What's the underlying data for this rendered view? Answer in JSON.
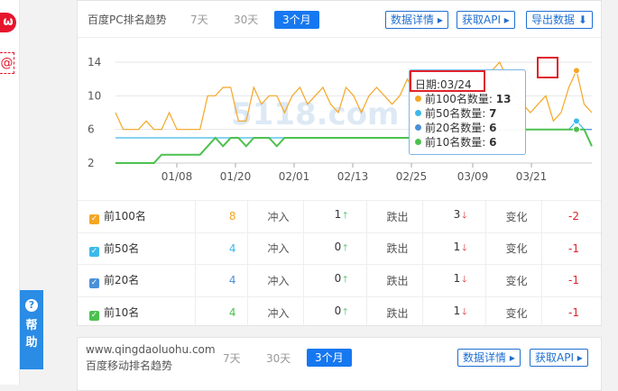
{
  "side": {
    "weibo_icon": "weibo-icon",
    "mail_icon": "mail-icon",
    "help_label": "帮助",
    "help_q": "?"
  },
  "card1": {
    "title": "百度PC排名趋势",
    "tabs": [
      "7天",
      "30天",
      "3个月"
    ],
    "buttons": {
      "detail": "数据详情 ▸",
      "api": "获取API ▸",
      "export": "导出数据 ⬇"
    }
  },
  "tooltip": {
    "date": "日期:03/24",
    "rows": [
      {
        "label": "前100名数量:",
        "value": "13",
        "color": "#f5a623"
      },
      {
        "label": "前50名数量:",
        "value": "7",
        "color": "#3cb9ea"
      },
      {
        "label": "前20名数量:",
        "value": "6",
        "color": "#4a90d9"
      },
      {
        "label": "前10名数量:",
        "value": "6",
        "color": "#4cc14f"
      }
    ]
  },
  "chart_data": {
    "type": "line",
    "yticks": [
      2,
      6,
      10,
      14
    ],
    "ylim": [
      2,
      14
    ],
    "xticks": [
      "01/08",
      "01/20",
      "02/01",
      "02/13",
      "02/25",
      "03/09",
      "03/21"
    ],
    "grid": true,
    "watermark": "5118.com",
    "series": [
      {
        "name": "前100名",
        "color": "#f5a623",
        "values": [
          8,
          6,
          6,
          6,
          7,
          6,
          6,
          8,
          6,
          6,
          6,
          6,
          10,
          10,
          11,
          11,
          7,
          7,
          11,
          9,
          10,
          10,
          8,
          10,
          11,
          9,
          10,
          11,
          9,
          8,
          11,
          10,
          8,
          10,
          11,
          10,
          9,
          10,
          12,
          10,
          9,
          10,
          11,
          10,
          11,
          12,
          13,
          12,
          11,
          13,
          14,
          12,
          10,
          9,
          8,
          9,
          10,
          7,
          8,
          11,
          13,
          9,
          8
        ]
      },
      {
        "name": "前50名",
        "color": "#3cb9ea",
        "values": [
          5,
          5,
          5,
          5,
          5,
          5,
          5,
          5,
          5,
          5,
          5,
          5,
          5,
          5,
          5,
          5,
          5,
          5,
          5,
          5,
          5,
          5,
          5,
          5,
          5,
          5,
          5,
          5,
          5,
          5,
          5,
          5,
          5,
          5,
          5,
          5,
          5,
          5,
          5,
          5,
          5,
          6,
          6,
          6,
          6,
          6,
          6,
          6,
          6,
          6,
          6,
          6,
          6,
          6,
          6,
          6,
          6,
          6,
          6,
          6,
          7,
          6,
          6
        ]
      },
      {
        "name": "前20名",
        "color": "#4a90d9",
        "values": [
          2,
          2,
          2,
          2,
          2,
          2,
          3,
          3,
          3,
          3,
          3,
          3,
          4,
          5,
          4,
          5,
          5,
          4,
          5,
          5,
          5,
          4,
          5,
          5,
          5,
          5,
          5,
          5,
          5,
          5,
          5,
          5,
          5,
          5,
          5,
          5,
          5,
          5,
          5,
          5,
          5,
          6,
          6,
          6,
          6,
          6,
          6,
          6,
          6,
          6,
          6,
          6,
          6,
          6,
          6,
          6,
          6,
          6,
          6,
          6,
          6,
          6,
          6
        ]
      },
      {
        "name": "前10名",
        "color": "#4cc14f",
        "values": [
          2,
          2,
          2,
          2,
          2,
          2,
          3,
          3,
          3,
          3,
          3,
          3,
          4,
          5,
          4,
          5,
          5,
          4,
          5,
          5,
          5,
          4,
          5,
          5,
          5,
          5,
          5,
          5,
          5,
          5,
          5,
          5,
          5,
          5,
          5,
          5,
          5,
          5,
          5,
          5,
          5,
          6,
          6,
          6,
          6,
          6,
          6,
          6,
          6,
          6,
          6,
          6,
          6,
          6,
          6,
          6,
          6,
          6,
          6,
          6,
          6,
          6,
          4
        ]
      }
    ]
  },
  "stats": {
    "headers": {
      "in": "冲入",
      "out": "跌出",
      "change": "变化"
    },
    "rows": [
      {
        "label": "前100名",
        "count": "8",
        "count_color": "#f5a623",
        "in": "1",
        "out": "3",
        "change": "-2",
        "check_color": "#f5a623"
      },
      {
        "label": "前50名",
        "count": "4",
        "count_color": "#3cb9ea",
        "in": "0",
        "out": "1",
        "change": "-1",
        "check_color": "#3cb9ea"
      },
      {
        "label": "前20名",
        "count": "4",
        "count_color": "#4a90d9",
        "in": "0",
        "out": "1",
        "change": "-1",
        "check_color": "#4a90d9"
      },
      {
        "label": "前10名",
        "count": "4",
        "count_color": "#4cc14f",
        "in": "0",
        "out": "1",
        "change": "-1",
        "check_color": "#4cc14f"
      }
    ]
  },
  "card2": {
    "domain": "www.qingdaoluohu.com",
    "title": "百度移动排名趋势",
    "tabs": [
      "7天",
      "30天",
      "3个月"
    ],
    "buttons": {
      "detail": "数据详情 ▸",
      "api": "获取API ▸"
    }
  }
}
